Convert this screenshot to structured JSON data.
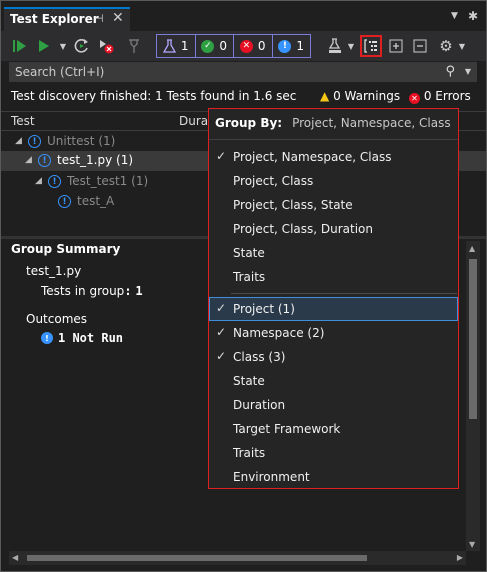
{
  "window": {
    "title": "Test Explorer",
    "pin": "⊣",
    "close": "✕"
  },
  "toolbar": {
    "counters": [
      {
        "icon": "flask-icon",
        "value": "1",
        "color": "#9a8cff"
      },
      {
        "icon": "passed-icon",
        "value": "0",
        "color": "#2ea043"
      },
      {
        "icon": "failed-icon",
        "value": "0",
        "color": "#e81123"
      },
      {
        "icon": "not-run-icon",
        "value": "1",
        "color": "#3794ff"
      }
    ],
    "accent": "#7b7bd8",
    "highlight": "#e02020"
  },
  "search": {
    "placeholder": "Search (Ctrl+I)"
  },
  "status": {
    "message": "Test discovery finished: 1 Tests found in 1.6 sec",
    "warnings": "0 Warnings",
    "errors": "0 Errors"
  },
  "columns": {
    "test": "Test",
    "duration": "Durat"
  },
  "tree": [
    {
      "label": "Unittest",
      "count": "(1)",
      "dim": true
    },
    {
      "label": "test_1.py",
      "count": "(1)",
      "dim": false
    },
    {
      "label": "Test_test1",
      "count": "(1)",
      "dim": true
    },
    {
      "label": "test_A",
      "count": "",
      "dim": true
    }
  ],
  "summary": {
    "title": "Group Summary",
    "group_name": "test_1.py",
    "tests_label": "Tests in group",
    "tests_sep": ":",
    "tests_value": "1",
    "outcomes_label": "Outcomes",
    "not_run": "1 Not Run"
  },
  "group_by": {
    "label": "Group By:",
    "current": "Project, Namespace, Class",
    "presets": [
      {
        "label": "Project, Namespace, Class",
        "checked": true
      },
      {
        "label": "Project, Class",
        "checked": false
      },
      {
        "label": "Project, Class, State",
        "checked": false
      },
      {
        "label": "Project, Class, Duration",
        "checked": false
      },
      {
        "label": "State",
        "checked": false
      },
      {
        "label": "Traits",
        "checked": false
      }
    ],
    "levels": [
      {
        "label": "Project (1)",
        "checked": true,
        "selected": true
      },
      {
        "label": "Namespace (2)",
        "checked": true,
        "selected": false
      },
      {
        "label": "Class (3)",
        "checked": true,
        "selected": false
      },
      {
        "label": "State",
        "checked": false,
        "selected": false
      },
      {
        "label": "Duration",
        "checked": false,
        "selected": false
      },
      {
        "label": "Target Framework",
        "checked": false,
        "selected": false
      },
      {
        "label": "Traits",
        "checked": false,
        "selected": false
      },
      {
        "label": "Environment",
        "checked": false,
        "selected": false
      }
    ]
  }
}
